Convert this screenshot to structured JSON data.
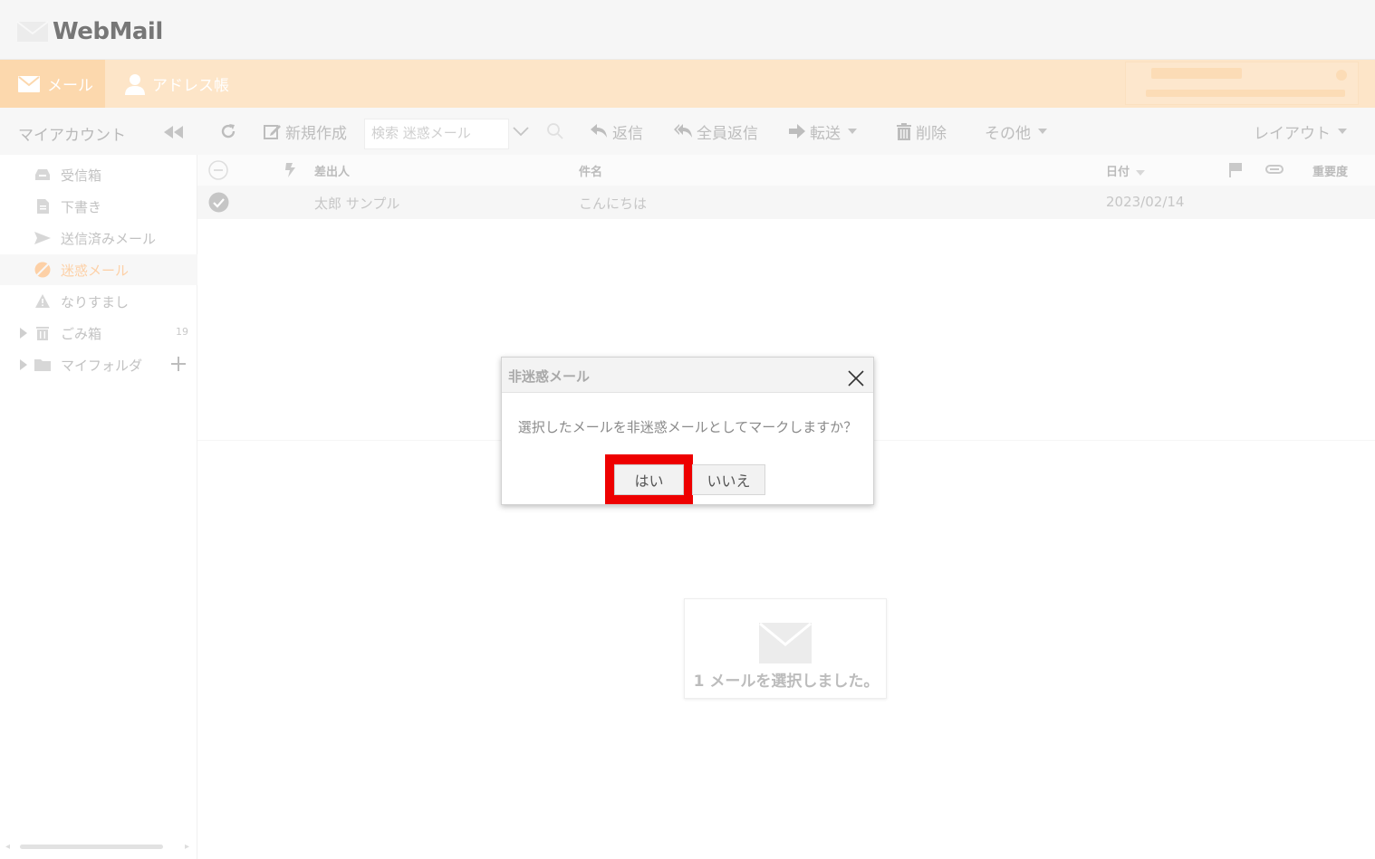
{
  "app": {
    "title": "WebMail"
  },
  "nav": {
    "mail_label": "メール",
    "address_label": "アドレス帳"
  },
  "sidebar": {
    "title": "マイアカウント",
    "folders": [
      {
        "label": "受信箱",
        "icon": "inbox-icon"
      },
      {
        "label": "下書き",
        "icon": "draft-icon"
      },
      {
        "label": "送信済みメール",
        "icon": "send-icon"
      },
      {
        "label": "迷惑メール",
        "icon": "spam-icon",
        "active": true
      },
      {
        "label": "なりすまし",
        "icon": "warning-icon"
      },
      {
        "label": "ごみ箱",
        "icon": "trash-icon",
        "count": "19"
      },
      {
        "label": "マイフォルダ",
        "icon": "folder-icon"
      }
    ]
  },
  "toolbar": {
    "new_label": "新規作成",
    "search_placeholder": "検索 迷惑メール",
    "reply_label": "返信",
    "reply_all_label": "全員返信",
    "forward_label": "転送",
    "delete_label": "削除",
    "more_label": "その他",
    "layout_label": "レイアウト"
  },
  "list": {
    "columns": {
      "from": "差出人",
      "subject": "件名",
      "date": "日付",
      "importance": "重要度"
    },
    "rows": [
      {
        "from": "太郎 サンプル",
        "subject": "こんにちは",
        "date": "2023/02/14",
        "selected": true
      }
    ]
  },
  "preview": {
    "text": "1 メールを選択しました。"
  },
  "dialog": {
    "title": "非迷惑メール",
    "message": "選択したメールを非迷惑メールとしてマークしますか？",
    "yes_label": "はい",
    "no_label": "いいえ"
  },
  "colors": {
    "accent": "#fde5c8",
    "highlight": "#ee0000"
  }
}
